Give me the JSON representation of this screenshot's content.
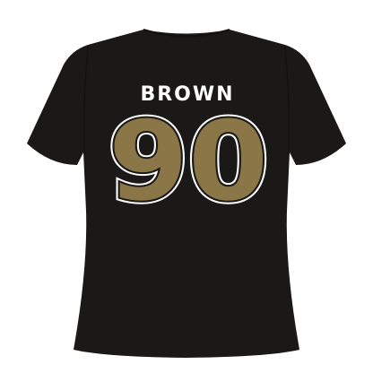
{
  "jersey": {
    "player_name": "BROWN",
    "player_number": "90"
  },
  "colors": {
    "background": "#ffffff",
    "shirt": "#1b1917",
    "shirt_shadow": "#121110",
    "name_text": "#ffffff",
    "number_fill": "#8a7646",
    "number_outline": "#ffffff",
    "number_inner_outline": "#1b1917"
  }
}
